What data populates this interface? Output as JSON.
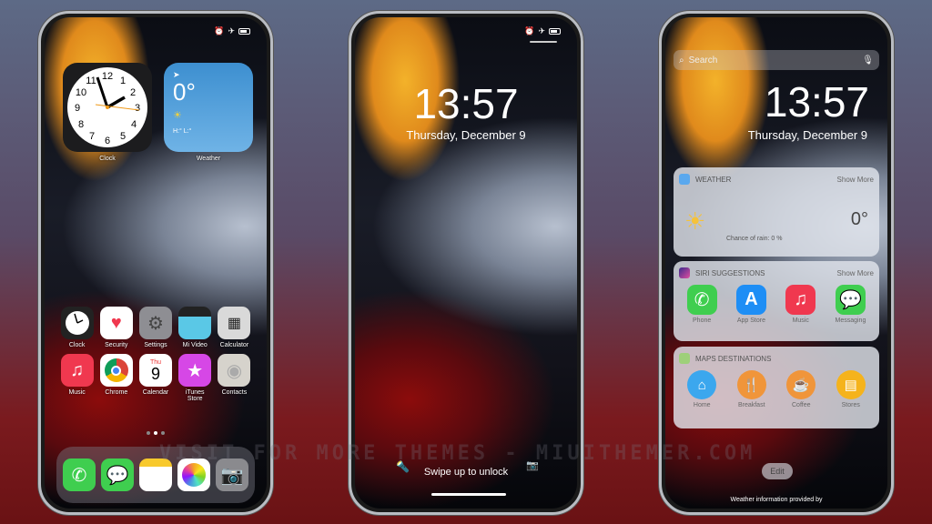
{
  "status": {
    "icons": [
      "alarm-icon",
      "airplane-icon",
      "battery-icon"
    ]
  },
  "home": {
    "widgets": {
      "clock_label": "Clock",
      "weather_label": "Weather",
      "weather_temp": "0°",
      "weather_hl": "H:° L:°"
    },
    "row1": [
      {
        "label": "Clock",
        "icon": "clock-icon",
        "color": "#222"
      },
      {
        "label": "Security",
        "icon": "heart-icon",
        "color": "#ffffff"
      },
      {
        "label": "Settings",
        "icon": "gear-icon",
        "color": "#8e8e93"
      },
      {
        "label": "Mi Video",
        "icon": "clapper-icon",
        "color": "#5ac8e6"
      },
      {
        "label": "Calculator",
        "icon": "calculator-icon",
        "color": "#d9d9d9"
      }
    ],
    "row2": [
      {
        "label": "Music",
        "icon": "music-note-icon",
        "color": "#f0384f"
      },
      {
        "label": "Chrome",
        "icon": "chrome-icon",
        "color": "#ffffff"
      },
      {
        "label": "Calendar",
        "icon": "calendar-icon",
        "color": "#ffffff",
        "day": "Thu",
        "date": "9"
      },
      {
        "label": "iTunes Store",
        "icon": "star-icon",
        "color": "#d647e6"
      },
      {
        "label": "Contacts",
        "icon": "contacts-icon",
        "color": "#d6d3cc"
      }
    ],
    "dock": [
      {
        "icon": "phone-icon",
        "color": "#3fce4f"
      },
      {
        "icon": "messages-icon",
        "color": "#3fce4f"
      },
      {
        "icon": "notes-icon",
        "color": "#ffffff"
      },
      {
        "icon": "photos-icon",
        "color": "#ffffff"
      },
      {
        "icon": "camera-icon",
        "color": "#8a8a8e"
      }
    ],
    "page_indicator": {
      "pages": 3,
      "current": 2
    }
  },
  "lock": {
    "time": "13:57",
    "date": "Thursday, December 9",
    "swipe": "Swipe up to unlock"
  },
  "today": {
    "search_placeholder": "Search",
    "time": "13:57",
    "date": "Thursday, December 9",
    "weather": {
      "title": "WEATHER",
      "more": "Show More",
      "temp": "0°",
      "rain": "Chance of rain: 0 %"
    },
    "siri": {
      "title": "SIRI SUGGESTIONS",
      "more": "Show More",
      "apps": [
        {
          "label": "Phone",
          "icon": "phone-icon",
          "color": "#3fce4f"
        },
        {
          "label": "App Store",
          "icon": "app-store-icon",
          "color": "#1e8ef5"
        },
        {
          "label": "Music",
          "icon": "music-note-icon",
          "color": "#f0384f"
        },
        {
          "label": "Messaging",
          "icon": "messages-icon",
          "color": "#3fce4f"
        }
      ]
    },
    "maps": {
      "title": "MAPS DESTINATIONS",
      "places": [
        {
          "label": "Home",
          "icon": "home-icon",
          "color": "#3ba7ee"
        },
        {
          "label": "Breakfast",
          "icon": "fork-knife-icon",
          "color": "#f0953a"
        },
        {
          "label": "Coffee",
          "icon": "coffee-icon",
          "color": "#f0953a"
        },
        {
          "label": "Stores",
          "icon": "store-icon",
          "color": "#f5b31c"
        }
      ]
    },
    "edit": "Edit",
    "footer": "Weather information provided by"
  },
  "watermark": "VISIT FOR MORE THEMES - MIUITHEMER.COM"
}
